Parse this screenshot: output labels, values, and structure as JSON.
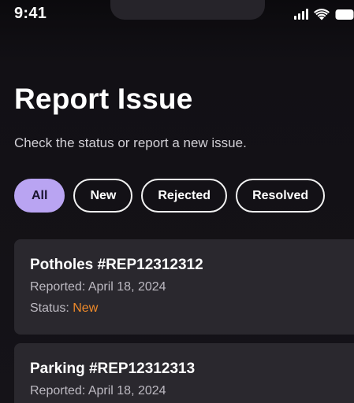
{
  "status_bar": {
    "time": "9:41"
  },
  "header": {
    "title": "Report Issue",
    "subtitle": "Check the status or report a new issue."
  },
  "filters": [
    {
      "label": "All",
      "active": true
    },
    {
      "label": "New",
      "active": false
    },
    {
      "label": "Rejected",
      "active": false
    },
    {
      "label": "Resolved",
      "active": false
    }
  ],
  "reports": [
    {
      "title": "Potholes #REP12312312",
      "reported": "Reported: April 18, 2024",
      "status_label": "Status: ",
      "status_value": "New"
    },
    {
      "title": "Parking #REP12312313",
      "reported": "Reported: April 18, 2024"
    }
  ],
  "colors": {
    "background": "#121015",
    "accent": "#b9a4f2",
    "card": "#2a282e",
    "status_new": "#ef8a2a"
  }
}
